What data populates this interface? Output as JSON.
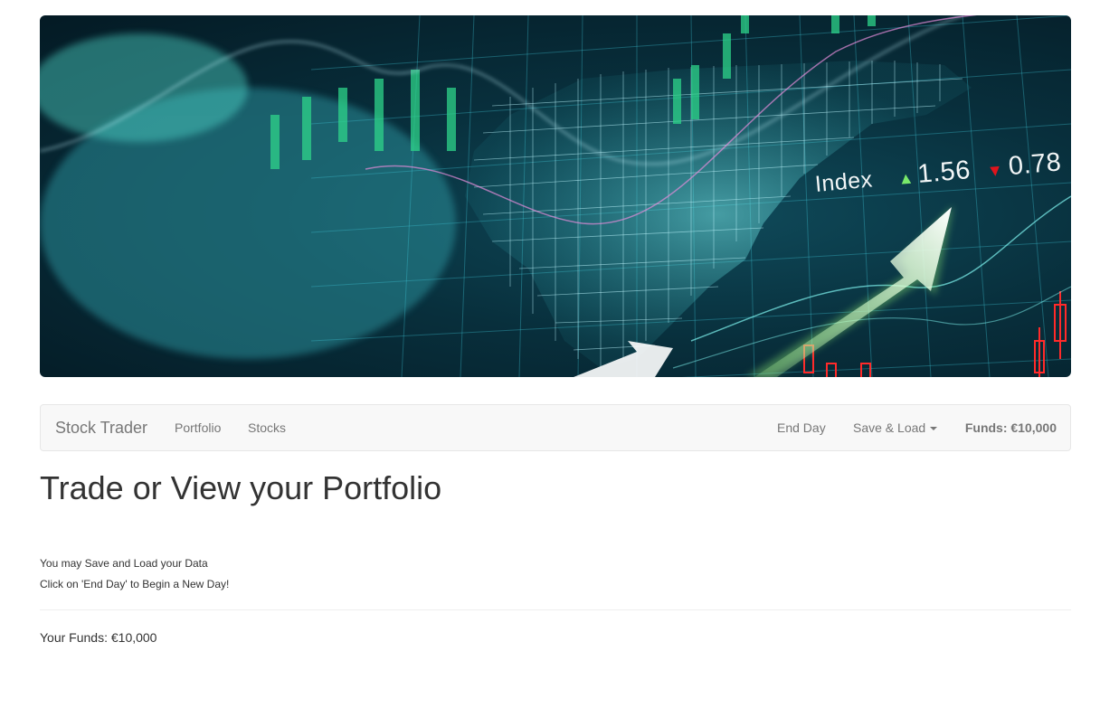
{
  "hero": {
    "index_label": "Index",
    "index_up": "1.56",
    "index_down": "0.78",
    "up_arrow_icon": "triangle-up-icon",
    "down_arrow_icon": "triangle-down-icon"
  },
  "navbar": {
    "brand": "Stock Trader",
    "links": [
      "Portfolio",
      "Stocks"
    ],
    "end_day": "End Day",
    "save_load": "Save & Load",
    "funds": "Funds: €10,000"
  },
  "main": {
    "title": "Trade or View your Portfolio",
    "info": [
      "You may Save and Load your Data",
      "Click on 'End Day' to Begin a New Day!"
    ],
    "funds": "Your Funds: €10,000"
  },
  "colors": {
    "accent_green": "#79e86a",
    "accent_red": "#e0141c",
    "navbar_bg": "#f8f8f8",
    "navbar_text": "#777777"
  }
}
